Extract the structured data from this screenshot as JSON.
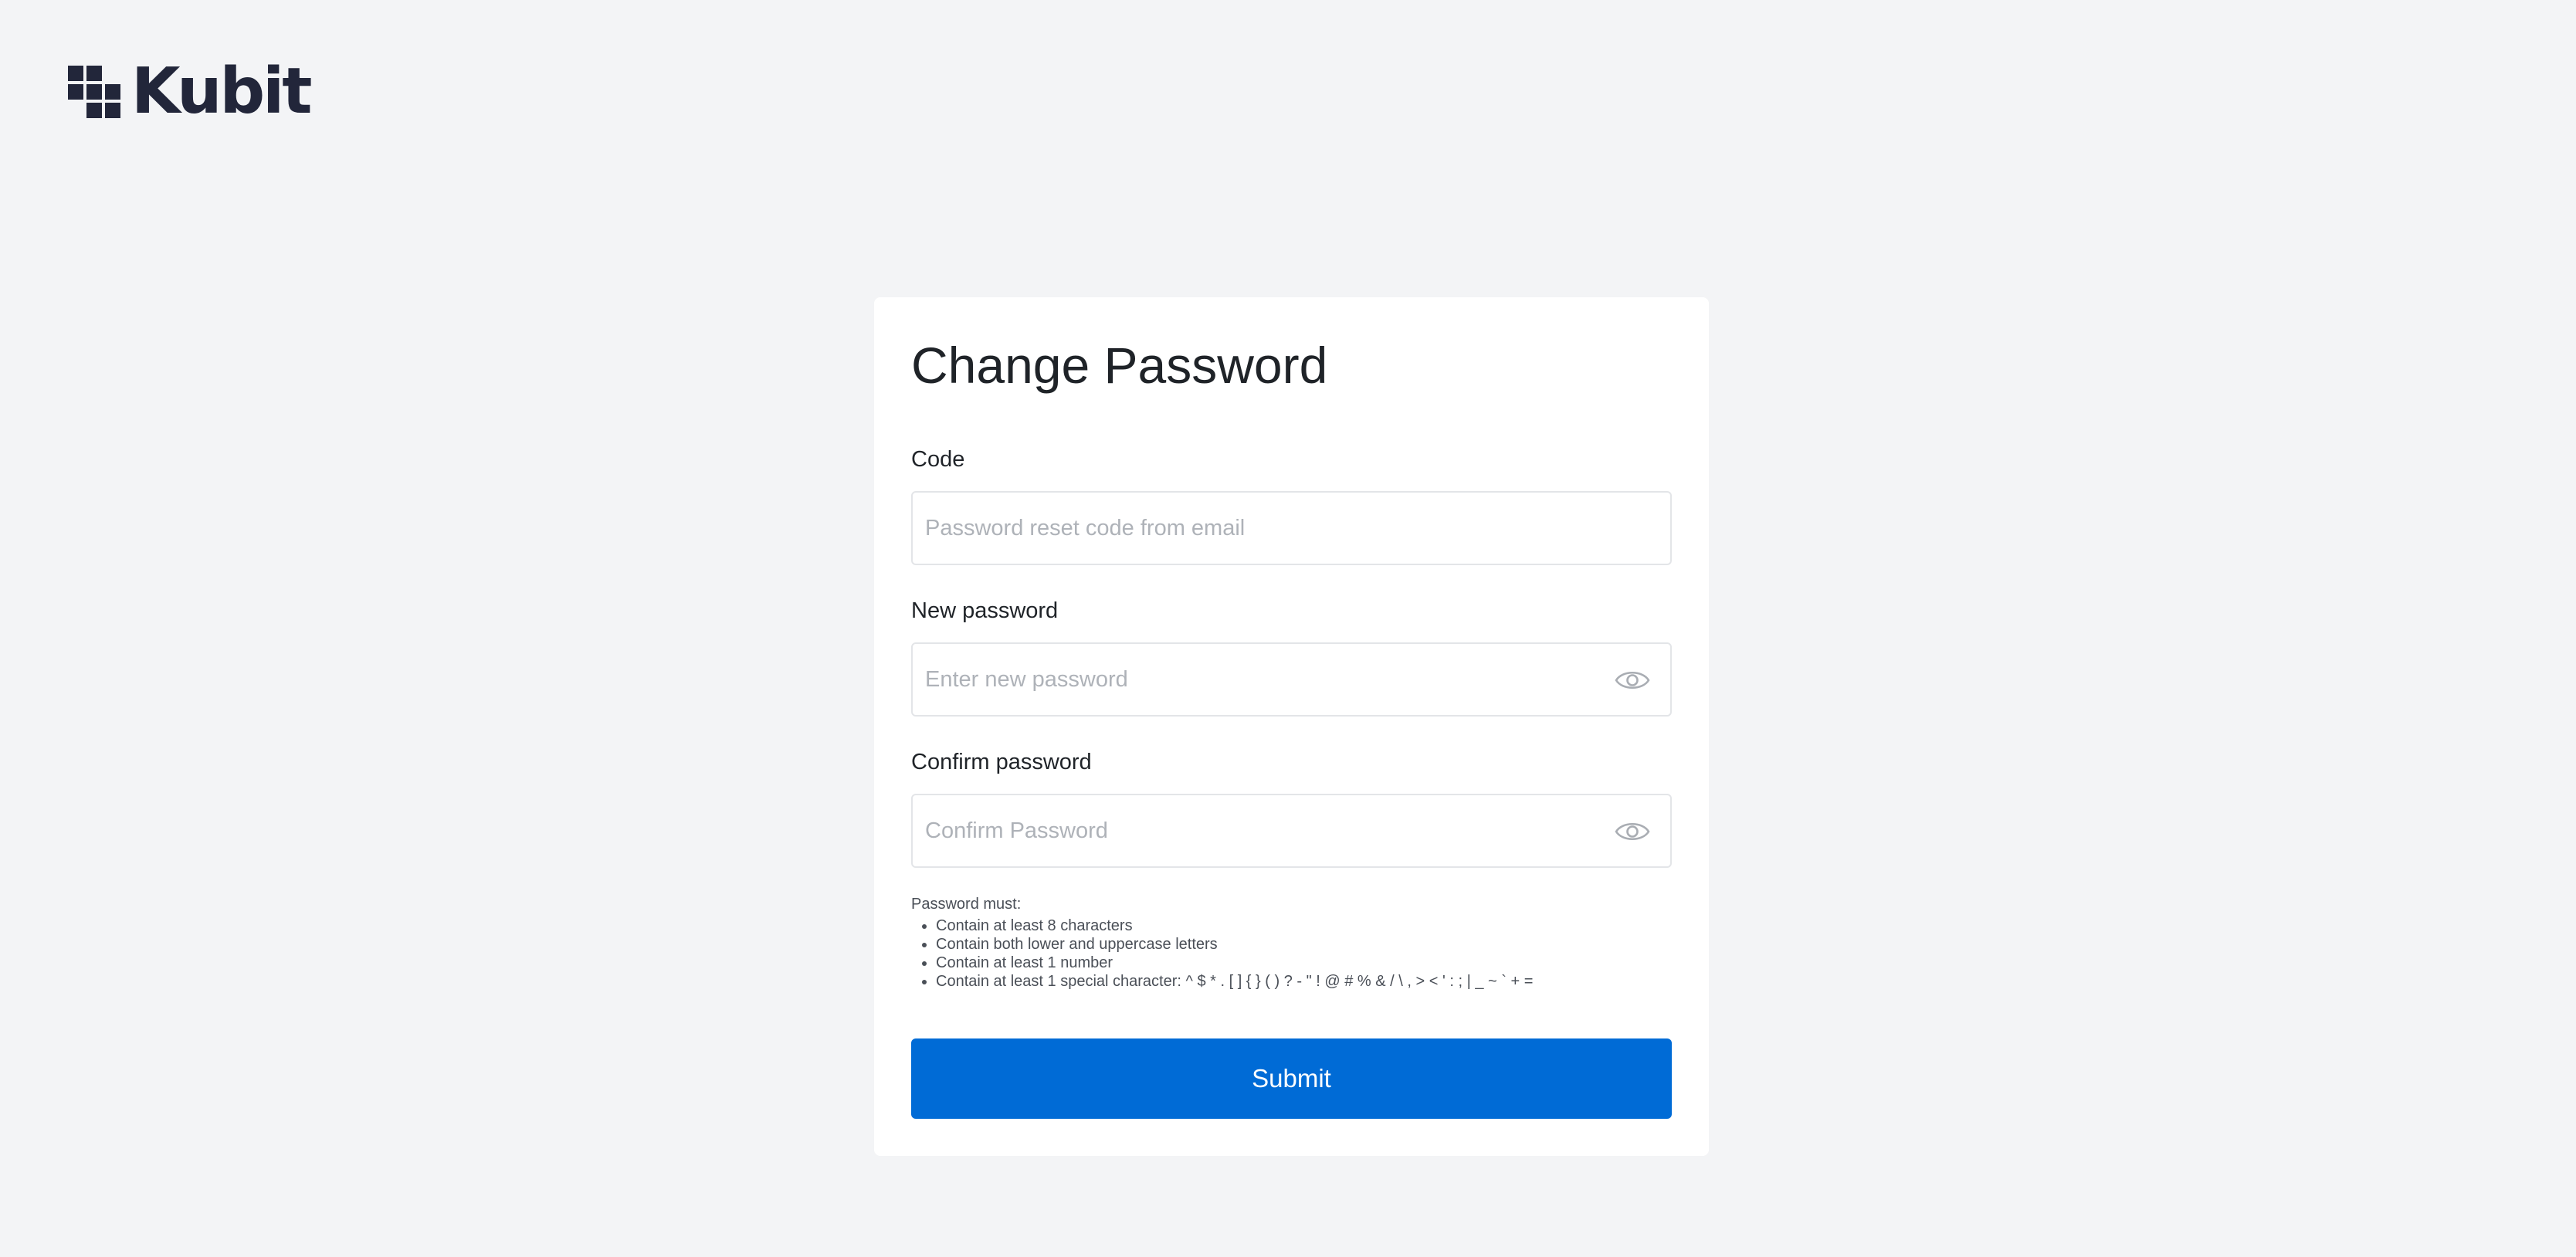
{
  "brand": {
    "name": "Kubit",
    "color": "#22263a"
  },
  "form": {
    "title": "Change Password",
    "code": {
      "label": "Code",
      "placeholder": "Password reset code from email",
      "value": ""
    },
    "new_password": {
      "label": "New password",
      "placeholder": "Enter new password",
      "value": "",
      "toggle_icon": "eye-icon"
    },
    "confirm_password": {
      "label": "Confirm password",
      "placeholder": "Confirm Password",
      "value": "",
      "toggle_icon": "eye-icon"
    },
    "rules": {
      "heading": "Password must:",
      "items": [
        "Contain at least 8 characters",
        "Contain both lower and uppercase letters",
        "Contain at least 1 number",
        "Contain at least 1 special character: ^ $ * . [ ] { } ( ) ? - \" ! @ # % & / \\ , > < ' : ; | _ ~ ` + ="
      ]
    },
    "submit_label": "Submit"
  },
  "colors": {
    "background": "#f3f4f6",
    "card": "#ffffff",
    "primary": "#006bd6",
    "placeholder": "#aeb2b8"
  }
}
